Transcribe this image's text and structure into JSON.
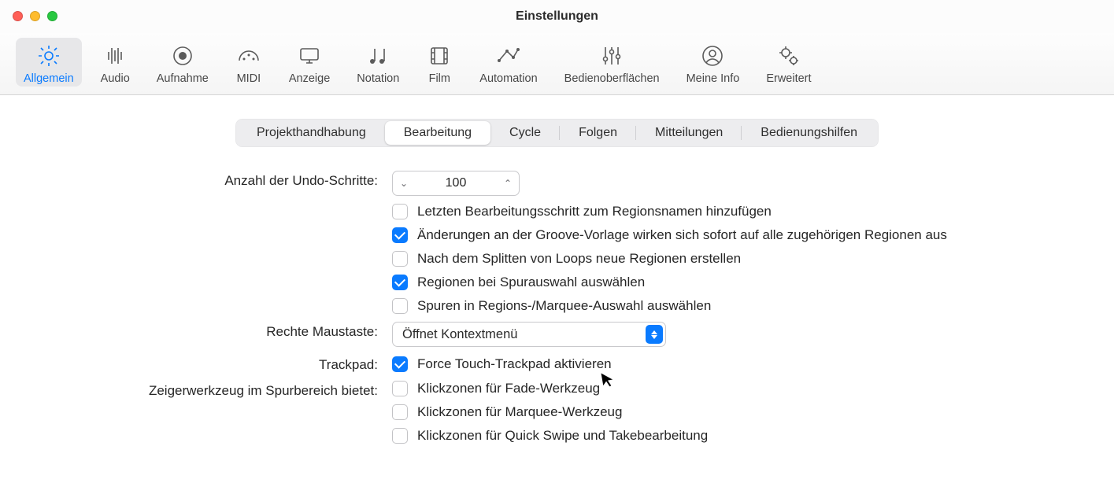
{
  "window": {
    "title": "Einstellungen"
  },
  "toolbar": {
    "items": [
      {
        "name": "allgemein",
        "label": "Allgemein"
      },
      {
        "name": "audio",
        "label": "Audio"
      },
      {
        "name": "aufnahme",
        "label": "Aufnahme"
      },
      {
        "name": "midi",
        "label": "MIDI"
      },
      {
        "name": "anzeige",
        "label": "Anzeige"
      },
      {
        "name": "notation",
        "label": "Notation"
      },
      {
        "name": "film",
        "label": "Film"
      },
      {
        "name": "automation",
        "label": "Automation"
      },
      {
        "name": "bedienoberflaechen",
        "label": "Bedienoberflächen"
      },
      {
        "name": "meine-info",
        "label": "Meine Info"
      },
      {
        "name": "erweitert",
        "label": "Erweitert"
      }
    ],
    "selected": "allgemein"
  },
  "tabs": {
    "items": [
      "Projekthandhabung",
      "Bearbeitung",
      "Cycle",
      "Folgen",
      "Mitteilungen",
      "Bedienungshilfen"
    ],
    "active_index": 1
  },
  "form": {
    "undo_label": "Anzahl der Undo-Schritte:",
    "undo_value": "100",
    "check_add_step": {
      "checked": false,
      "label": "Letzten Bearbeitungsschritt zum Regionsnamen hinzufügen"
    },
    "check_groove": {
      "checked": true,
      "label": "Änderungen an der Groove-Vorlage wirken sich sofort auf alle zugehörigen Regionen aus"
    },
    "check_split": {
      "checked": false,
      "label": "Nach dem Splitten von Loops neue Regionen erstellen"
    },
    "check_region_sel": {
      "checked": true,
      "label": "Regionen bei Spurauswahl auswählen"
    },
    "check_track_sel": {
      "checked": false,
      "label": "Spuren in Regions-/Marquee-Auswahl auswählen"
    },
    "right_mouse_label": "Rechte Maustaste:",
    "right_mouse_value": "Öffnet Kontextmenü",
    "trackpad_label": "Trackpad:",
    "check_trackpad": {
      "checked": true,
      "label": "Force Touch-Trackpad aktivieren"
    },
    "pointer_label": "Zeigerwerkzeug im Spurbereich bietet:",
    "check_fade": {
      "checked": false,
      "label": "Klickzonen für Fade-Werkzeug"
    },
    "check_marquee": {
      "checked": false,
      "label": "Klickzonen für Marquee-Werkzeug"
    },
    "check_quickswipe": {
      "checked": false,
      "label": "Klickzonen für Quick Swipe und Takebearbeitung"
    }
  }
}
